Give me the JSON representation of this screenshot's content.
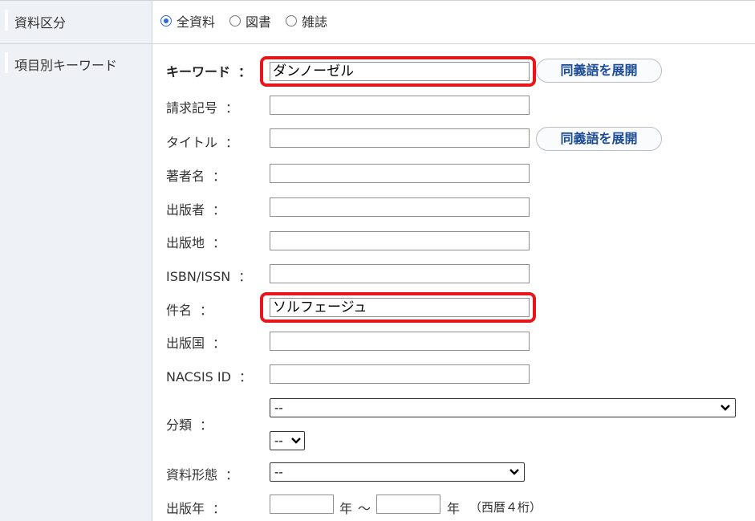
{
  "material_type": {
    "label": "資料区分",
    "options": [
      {
        "label": "全資料",
        "selected": true
      },
      {
        "label": "図書",
        "selected": false
      },
      {
        "label": "雑誌",
        "selected": false
      }
    ]
  },
  "keyword_section": {
    "label": "項目別キーワード",
    "expand_button_label": "同義語を展開",
    "fields": {
      "keyword": {
        "label": "キーワード",
        "value": "ダンノーゼル"
      },
      "call_number": {
        "label": "請求記号",
        "value": ""
      },
      "title": {
        "label": "タイトル",
        "value": ""
      },
      "author": {
        "label": "著者名",
        "value": ""
      },
      "publisher": {
        "label": "出版者",
        "value": ""
      },
      "place": {
        "label": "出版地",
        "value": ""
      },
      "isbn": {
        "label": "ISBN/ISSN",
        "value": ""
      },
      "subject": {
        "label": "件名",
        "value": "ソルフェージュ"
      },
      "country": {
        "label": "出版国",
        "value": ""
      },
      "nacsis": {
        "label": "NACSIS ID",
        "value": ""
      }
    },
    "classification": {
      "label": "分類",
      "select1": "--",
      "select2": "--"
    },
    "material_form": {
      "label": "資料形態",
      "value": "--"
    },
    "pub_year": {
      "label": "出版年",
      "year_suffix": "年",
      "tilde": "～",
      "note": "（西暦４桁）"
    }
  },
  "colon": "：",
  "colors": {
    "highlight": "#e8161b",
    "button_text": "#1b4b95",
    "radio_accent": "#2b6cd6",
    "label_bg": "#eef1f5"
  }
}
